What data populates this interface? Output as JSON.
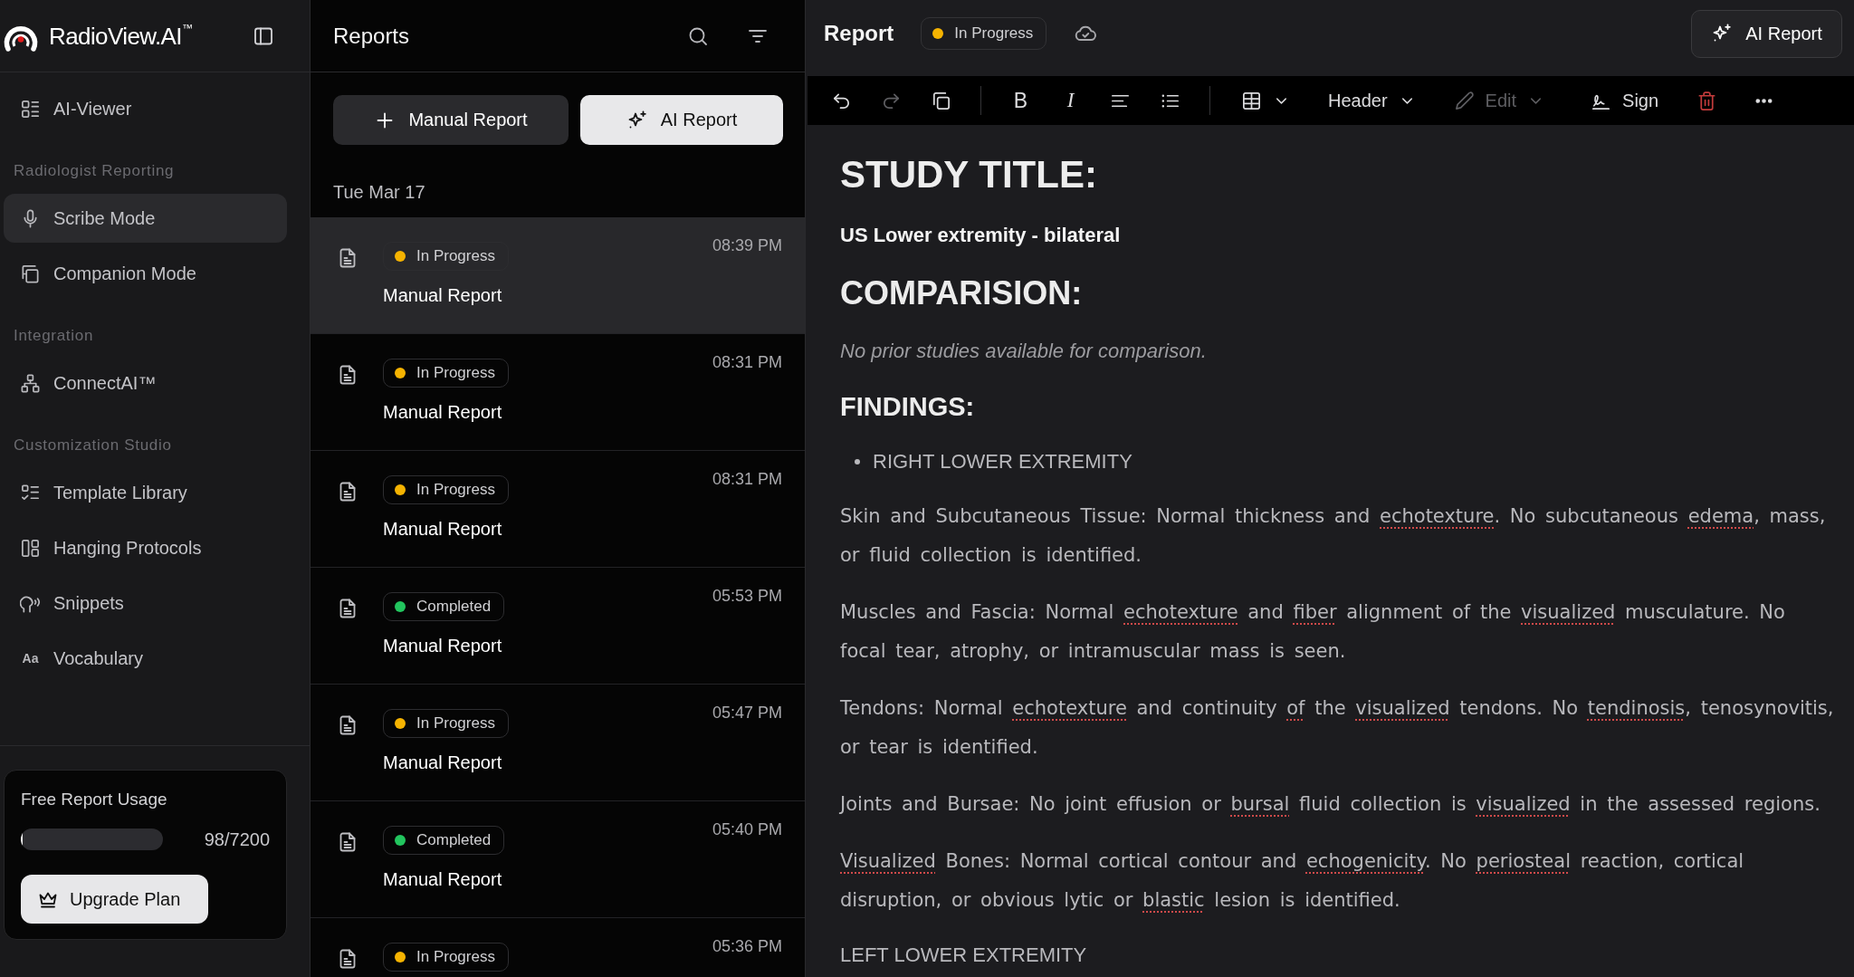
{
  "sidebar": {
    "brand": "RadioView.AI$^{™}$",
    "items": [
      {
        "label": "AI-Viewer",
        "selected": false
      }
    ],
    "sections": [
      {
        "title": "Radiologist Reporting",
        "items": [
          {
            "label": "Scribe Mode",
            "selected": true
          },
          {
            "label": "Companion Mode",
            "selected": false
          }
        ]
      },
      {
        "title": "Integration",
        "items": [
          {
            "label": "ConnectAI™",
            "selected": false
          }
        ]
      },
      {
        "title": "Customization Studio",
        "items": [
          {
            "label": "Template Library",
            "selected": false
          },
          {
            "label": "Hanging Protocols",
            "selected": false
          },
          {
            "label": "Snippets",
            "selected": false
          },
          {
            "label": "Vocabulary",
            "selected": false,
            "glyph": "Aa"
          }
        ]
      }
    ],
    "usage": {
      "title": "Free Report Usage",
      "level": 0.0136,
      "reading": "98/7200",
      "button": "Upgrade Plan"
    }
  },
  "reports": {
    "title": "Reports",
    "buttons": [
      {
        "label": "Manual Report",
        "kind": "secondary"
      },
      {
        "label": "AI Report",
        "kind": "primary"
      }
    ],
    "date": "Tue Mar 17",
    "items": [
      {
        "status": "In Progress",
        "color": "#f5b301",
        "title": "Manual Report",
        "time": "08:39 PM",
        "selected": true
      },
      {
        "status": "In Progress",
        "color": "#f5b301",
        "title": "Manual Report",
        "time": "08:31 PM",
        "selected": false
      },
      {
        "status": "In Progress",
        "color": "#f5b301",
        "title": "Manual Report",
        "time": "08:31 PM",
        "selected": false
      },
      {
        "status": "Completed",
        "color": "#22c55e",
        "title": "Manual Report",
        "time": "05:53 PM",
        "selected": false
      },
      {
        "status": "In Progress",
        "color": "#f5b301",
        "title": "Manual Report",
        "time": "05:47 PM",
        "selected": false
      },
      {
        "status": "Completed",
        "color": "#22c55e",
        "title": "Manual Report",
        "time": "05:40 PM",
        "selected": false
      },
      {
        "status": "In Progress",
        "color": "#f5b301",
        "time": "05:36 PM",
        "selected": false
      }
    ]
  },
  "editor": {
    "title": "Report",
    "status": "In Progress",
    "ai_button": "AI Report",
    "toolbar": [
      {
        "disabled": false
      },
      {
        "disabled": true
      },
      {
        "disabled": false
      },
      {
        "glyph": "B",
        "disabled": false
      },
      {
        "glyph": "I",
        "disabled": false
      },
      {
        "disabled": false
      },
      {
        "disabled": false
      },
      {
        "disabled": false
      },
      {
        "label": "Header",
        "disabled": false
      },
      {
        "label": "Edit",
        "disabled": true
      },
      {
        "label": "Sign",
        "disabled": false
      },
      {
        "disabled": false
      },
      {
        "disabled": false
      }
    ],
    "document": [
      {
        "kind": "title",
        "text": "STUDY TITLE:"
      },
      {
        "kind": "subtitle",
        "text": "US Lower extremity - bilateral"
      },
      {
        "kind": "heading",
        "text": "COMPARISION:"
      },
      {
        "kind": "note",
        "text": "No prior studies available for comparison."
      },
      {
        "kind": "subheading",
        "text": "FINDINGS:"
      },
      {
        "kind": "bullet",
        "text": "RIGHT LOWER EXTREMITY"
      },
      {
        "kind": "paragraph",
        "segments": [
          {
            "text": "Skin and Subcutaneous Tissue: Normal thickness and ",
            "flagged": false
          },
          {
            "text": "echotexture",
            "flagged": true
          },
          {
            "text": ". No subcutaneous ",
            "flagged": false
          },
          {
            "text": "edema",
            "flagged": true
          },
          {
            "text": ", mass, or fluid collection is identified.",
            "flagged": false
          }
        ]
      },
      {
        "kind": "paragraph",
        "segments": [
          {
            "text": "Muscles and Fascia: Normal ",
            "flagged": false
          },
          {
            "text": "echotexture",
            "flagged": true
          },
          {
            "text": " and ",
            "flagged": false
          },
          {
            "text": "fiber",
            "flagged": true
          },
          {
            "text": " alignment of the ",
            "flagged": false
          },
          {
            "text": "visualized",
            "flagged": true
          },
          {
            "text": " musculature. No focal tear, atrophy, or intramuscular mass is seen.",
            "flagged": false
          }
        ]
      },
      {
        "kind": "paragraph",
        "segments": [
          {
            "text": "Tendons: Normal ",
            "flagged": false
          },
          {
            "text": "echotexture",
            "flagged": true
          },
          {
            "text": " and continuity ",
            "flagged": false
          },
          {
            "text": "of",
            "flagged": true
          },
          {
            "text": " the ",
            "flagged": false
          },
          {
            "text": "visualized",
            "flagged": true
          },
          {
            "text": " tendons. No ",
            "flagged": false
          },
          {
            "text": "tendinosis",
            "flagged": true
          },
          {
            "text": ", tenosynovitis, or tear is identified.",
            "flagged": false
          }
        ]
      },
      {
        "kind": "paragraph",
        "segments": [
          {
            "text": "Joints and Bursae: No joint effusion or ",
            "flagged": false
          },
          {
            "text": "bursal",
            "flagged": true
          },
          {
            "text": " fluid collection is ",
            "flagged": false
          },
          {
            "text": "visualized",
            "flagged": true
          },
          {
            "text": " in the assessed regions.",
            "flagged": false
          }
        ]
      },
      {
        "kind": "paragraph",
        "segments": [
          {
            "text": "Visualized",
            "flagged": true
          },
          {
            "text": " Bones: Normal cortical contour and ",
            "flagged": false
          },
          {
            "text": "echogenicity",
            "flagged": true
          },
          {
            "text": ". No ",
            "flagged": false
          },
          {
            "text": "periosteal",
            "flagged": true
          },
          {
            "text": " reaction, cortical disruption, or obvious lytic or ",
            "flagged": false
          },
          {
            "text": "blastic",
            "flagged": true
          },
          {
            "text": " lesion is identified.",
            "flagged": false
          }
        ]
      },
      {
        "kind": "plain",
        "text": "LEFT LOWER EXTREMITY"
      }
    ]
  }
}
